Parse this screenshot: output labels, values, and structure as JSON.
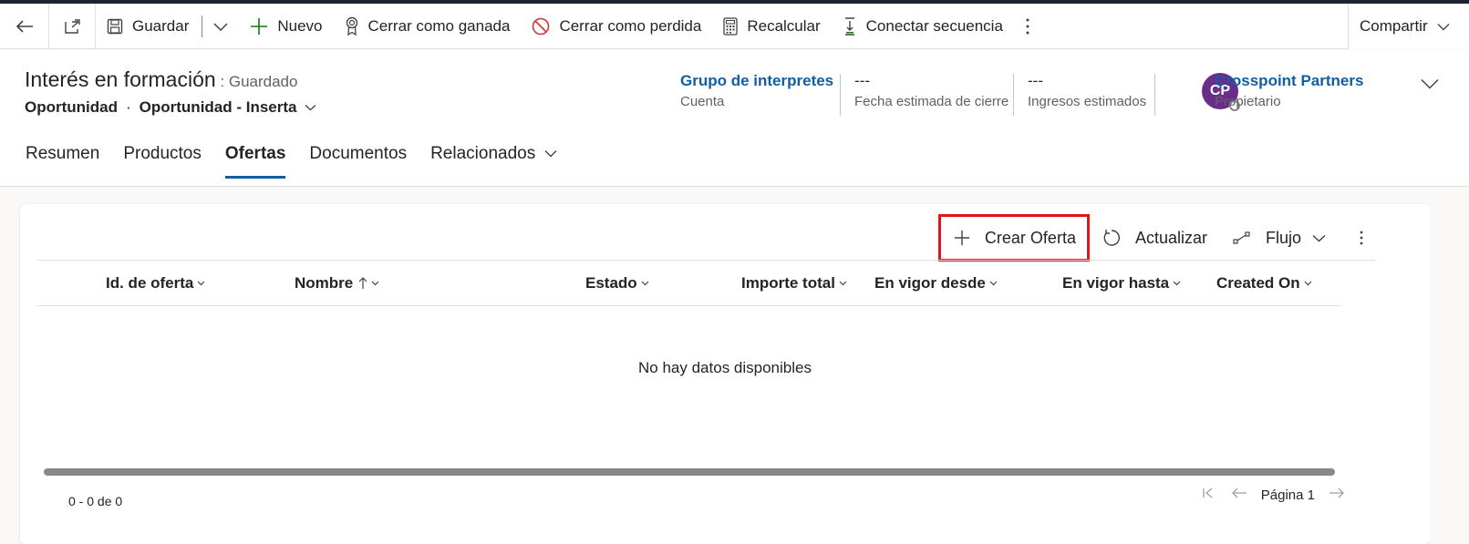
{
  "command_bar": {
    "save_label": "Guardar",
    "new_label": "Nuevo",
    "close_won_label": "Cerrar como ganada",
    "close_lost_label": "Cerrar como perdida",
    "recalc_label": "Recalcular",
    "connect_seq_label": "Conectar secuencia",
    "share_label": "Compartir"
  },
  "record": {
    "title": "Interés en formación",
    "status": " : Guardado",
    "entity": "Oportunidad",
    "form": "Oportunidad - Inserta"
  },
  "header_fields": [
    {
      "value": "Grupo de interpretes",
      "label": "Cuenta"
    },
    {
      "value": "---",
      "label": "Fecha estimada de cierre"
    },
    {
      "value": "---",
      "label": "Ingresos estimados"
    },
    {
      "value": "Crosspoint Partners",
      "label": "Propietario",
      "initials": "CP"
    }
  ],
  "tabs": [
    "Resumen",
    "Productos",
    "Ofertas",
    "Documentos",
    "Relacionados"
  ],
  "active_tab": "Ofertas",
  "subgrid": {
    "create_label": "Crear Oferta",
    "refresh_label": "Actualizar",
    "flow_label": "Flujo",
    "columns": [
      "Id. de oferta",
      "Nombre",
      "Estado",
      "Importe total",
      "En vigor desde",
      "En vigor hasta",
      "Created On"
    ],
    "empty_text": "No hay datos disponibles",
    "count_text": "0 - 0 de 0",
    "page_text": "Página 1"
  },
  "colors": {
    "accent": "#115ea3",
    "highlight": "#e3141c",
    "avatar": "#6b2d8b",
    "topbar": "#1b2232"
  }
}
